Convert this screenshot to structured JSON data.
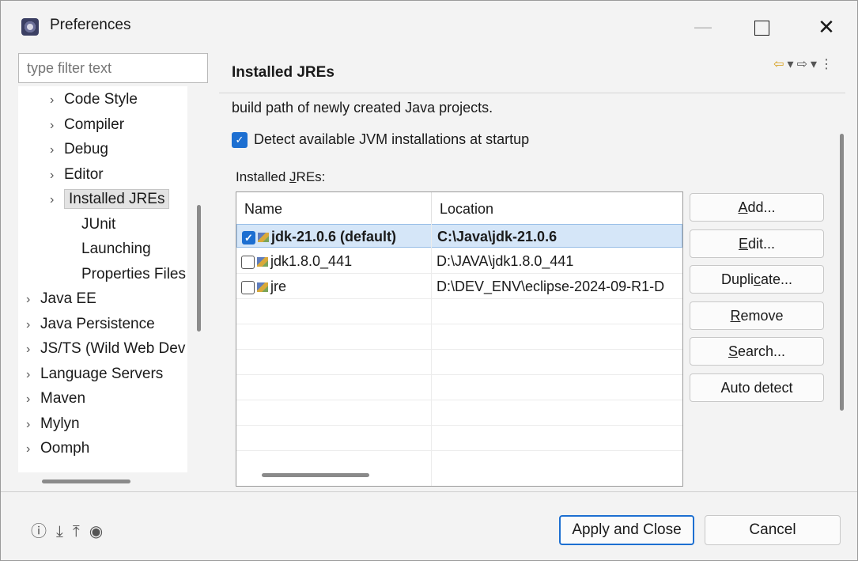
{
  "window": {
    "title": "Preferences",
    "min_glyph": "—",
    "close_glyph": "✕"
  },
  "filter": {
    "placeholder": "type filter text"
  },
  "tree": {
    "items": [
      {
        "label": "Code Style",
        "expanded": false,
        "indent": 1
      },
      {
        "label": "Compiler",
        "expanded": false,
        "indent": 1
      },
      {
        "label": "Debug",
        "expanded": false,
        "indent": 1
      },
      {
        "label": "Editor",
        "expanded": false,
        "indent": 1
      },
      {
        "label": "Installed JREs",
        "expanded": false,
        "indent": 1,
        "selected": true
      },
      {
        "label": "JUnit",
        "indent": 2
      },
      {
        "label": "Launching",
        "indent": 2
      },
      {
        "label": "Properties Files E",
        "indent": 2
      },
      {
        "label": "Java EE",
        "expanded": false,
        "indent": 0
      },
      {
        "label": "Java Persistence",
        "expanded": false,
        "indent": 0
      },
      {
        "label": "JS/TS (Wild Web Dev",
        "expanded": false,
        "indent": 0
      },
      {
        "label": "Language Servers",
        "expanded": false,
        "indent": 0
      },
      {
        "label": "Maven",
        "expanded": false,
        "indent": 0
      },
      {
        "label": "Mylyn",
        "expanded": false,
        "indent": 0
      },
      {
        "label": "Oomph",
        "expanded": false,
        "indent": 0
      }
    ]
  },
  "panel": {
    "title": "Installed JREs",
    "description": "build path of newly created Java projects.",
    "detect_label": "Detect available JVM installations at startup",
    "detect_checked": true,
    "jres_label_prefix": "Installed ",
    "jres_label_mnemonic": "J",
    "jres_label_suffix": "REs:"
  },
  "table": {
    "columns": [
      "Name",
      "Location"
    ],
    "rows": [
      {
        "name": "jdk-21.0.6 (default)",
        "location": "C:\\Java\\jdk-21.0.6",
        "checked": true,
        "selected": true
      },
      {
        "name": "jdk1.8.0_441",
        "location": "D:\\JAVA\\jdk1.8.0_441",
        "checked": false
      },
      {
        "name": "jre",
        "location": "D:\\DEV_ENV\\eclipse-2024-09-R1-D",
        "checked": false
      }
    ]
  },
  "buttons": [
    {
      "pre": "",
      "mn": "A",
      "post": "dd..."
    },
    {
      "pre": "",
      "mn": "E",
      "post": "dit..."
    },
    {
      "pre": "Dupli",
      "mn": "c",
      "post": "ate..."
    },
    {
      "pre": "",
      "mn": "R",
      "post": "emove"
    },
    {
      "pre": "",
      "mn": "S",
      "post": "earch..."
    },
    {
      "pre": "Auto detect",
      "mn": "",
      "post": ""
    }
  ],
  "footer": {
    "apply_label": "Apply and Close",
    "cancel_label": "Cancel"
  },
  "colors": {
    "accent": "#1d6fd1",
    "selection": "#d5e6f8"
  }
}
